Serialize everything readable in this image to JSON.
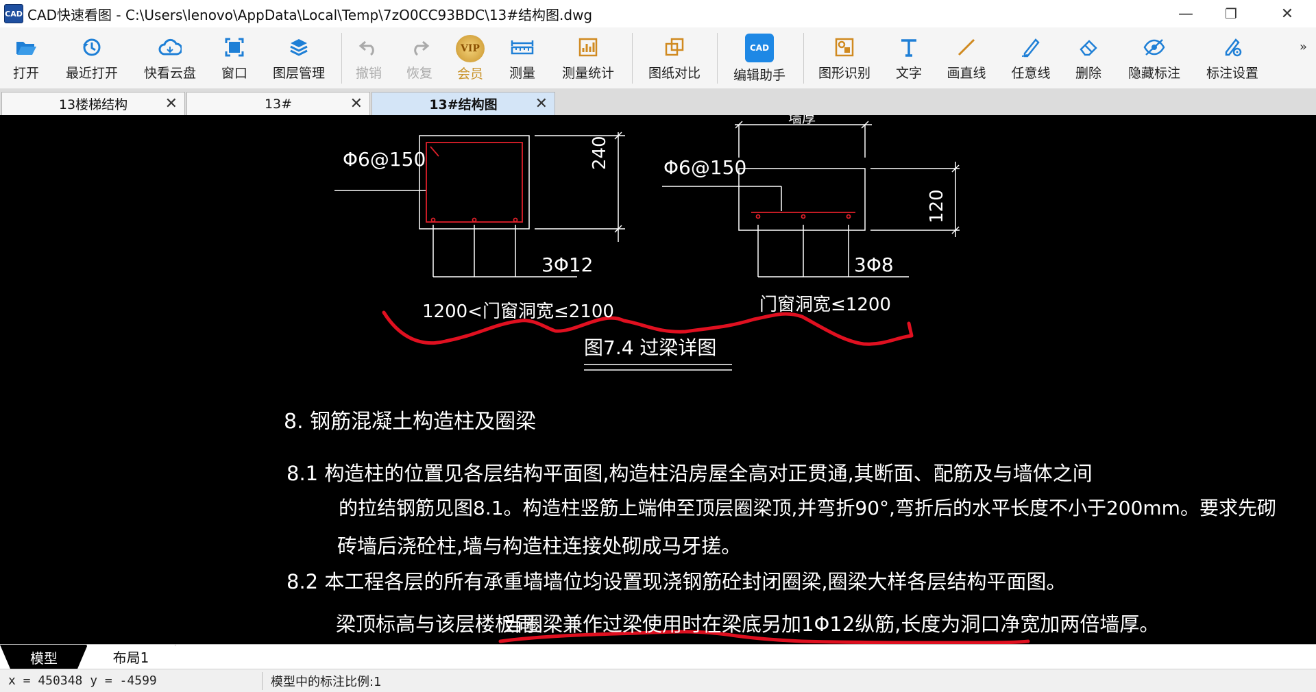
{
  "window": {
    "app_logo": "CAD",
    "title": "CAD快速看图 - C:\\Users\\lenovo\\AppData\\Local\\Temp\\7zO0CC93BDC\\13#结构图.dwg",
    "minimize": "—",
    "restore": "❐",
    "close": "✕"
  },
  "toolbar": {
    "items": [
      {
        "label": "打开",
        "icon": "folder-open-icon"
      },
      {
        "label": "最近打开",
        "icon": "history-icon"
      },
      {
        "label": "快看云盘",
        "icon": "cloud-icon"
      },
      {
        "label": "窗口",
        "icon": "window-icon"
      },
      {
        "label": "图层管理",
        "icon": "layers-icon"
      },
      {
        "label": "撤销",
        "icon": "undo-icon"
      },
      {
        "label": "恢复",
        "icon": "redo-icon"
      },
      {
        "label": "会员",
        "icon": "vip-badge-icon",
        "badge": "VIP"
      },
      {
        "label": "测量",
        "icon": "ruler-icon"
      },
      {
        "label": "测量统计",
        "icon": "measure-stats-icon"
      },
      {
        "label": "图纸对比",
        "icon": "compare-icon"
      },
      {
        "label": "编辑助手",
        "icon": "edit-assistant-icon",
        "badge": "CAD"
      },
      {
        "label": "图形识别",
        "icon": "shape-recognition-icon"
      },
      {
        "label": "文字",
        "icon": "text-icon"
      },
      {
        "label": "画直线",
        "icon": "line-icon"
      },
      {
        "label": "任意线",
        "icon": "freehand-pen-icon"
      },
      {
        "label": "删除",
        "icon": "eraser-icon"
      },
      {
        "label": "隐藏标注",
        "icon": "hide-eye-icon"
      },
      {
        "label": "标注设置",
        "icon": "annotation-settings-icon"
      }
    ],
    "overflow": "»"
  },
  "doc_tabs": [
    {
      "label": "13楼梯结构",
      "close": "✕"
    },
    {
      "label": "13#",
      "close": "✕"
    },
    {
      "label": "13#结构图",
      "close": "✕",
      "active": true
    }
  ],
  "drawing": {
    "left_detail": {
      "stirrup": "Φ6@150",
      "dim": "240",
      "rebar": "3Φ12",
      "caption": "1200<门窗洞宽≤2100"
    },
    "right_detail": {
      "top_dim": "墙厚",
      "stirrup": "Φ6@150",
      "dim": "120",
      "rebar": "3Φ8",
      "caption": "门窗洞宽≤1200"
    },
    "figure_title": "图7.4  过梁详图",
    "notes": [
      "8.   钢筋混凝土构造柱及圈梁",
      "8.1  构造柱的位置见各层结构平面图,构造柱沿房屋全高对正贯通,其断面、配筋及与墙体之间",
      "的拉结钢筋见图8.1。构造柱竖筋上端伸至顶层圈梁顶,并弯折90°,弯折后的水平长度不小于200mm。要求先砌",
      "砖墙后浇砼柱,墙与构造柱连接处砌成马牙搓。",
      "8.2  本工程各层的所有承重墙墙位均设置现浇钢筋砼封闭圈梁,圈梁大样各层结构平面图。",
      "梁顶标高与该层楼板同。",
      "当圈梁兼作过梁使用时在梁底另加1Φ12纵筋,长度为洞口净宽加两倍墙厚。"
    ]
  },
  "layout_tabs": [
    {
      "label": "模型",
      "active": true
    },
    {
      "label": "布局1"
    }
  ],
  "status": {
    "coords": "x = 450348  y = -4599",
    "scale": "模型中的标注比例:1"
  },
  "colors": {
    "canvas": "#000000",
    "line": "#ffffff",
    "rebar": "#e0202a",
    "annotation": "#e01020",
    "active_tab": "#d4e5f7"
  }
}
